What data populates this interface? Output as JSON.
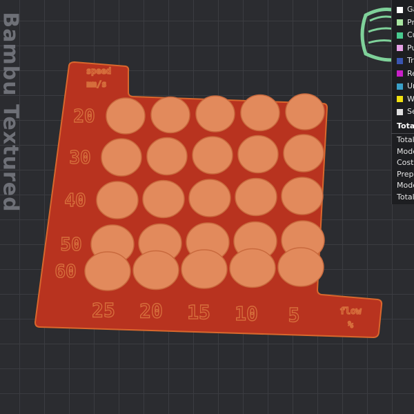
{
  "viewport": {
    "bed_label": "Bambu Textured",
    "colors": {
      "background": "#2b2c30",
      "grid_line": "#3b3c41",
      "plate_fill": "#b8331f",
      "plate_edge": "#d9672d",
      "disc_fill": "#e28a5c",
      "text_relief": "#d66e3c",
      "wipe_tower": "#7fd19a"
    }
  },
  "model": {
    "speed_header": [
      "speed",
      "mm/s"
    ],
    "speed_values": [
      "20",
      "30",
      "40",
      "50",
      "60"
    ],
    "flow_values": [
      "25",
      "20",
      "15",
      "10",
      "5"
    ],
    "flow_header": [
      "flow",
      "%"
    ],
    "grid_rows": 5,
    "grid_cols": 5
  },
  "legend": {
    "items": [
      {
        "label": "Ga",
        "color": "#ffffff"
      },
      {
        "label": "Pr",
        "color": "#a8e6a1"
      },
      {
        "label": "Cu",
        "color": "#48c98f"
      },
      {
        "label": "Pu",
        "color": "#e6a1e6"
      },
      {
        "label": "Tr",
        "color": "#3a55b0"
      },
      {
        "label": "Re",
        "color": "#c81fc8"
      },
      {
        "label": "Ur",
        "color": "#3aa0c8"
      },
      {
        "label": "W",
        "color": "#f0e010"
      },
      {
        "label": "Se",
        "color": "#e0e0e0"
      }
    ]
  },
  "stats": {
    "header": "Tota",
    "rows": [
      "Total",
      "Mode",
      "Cost:",
      "Prepa",
      "Mode",
      "Total"
    ]
  }
}
